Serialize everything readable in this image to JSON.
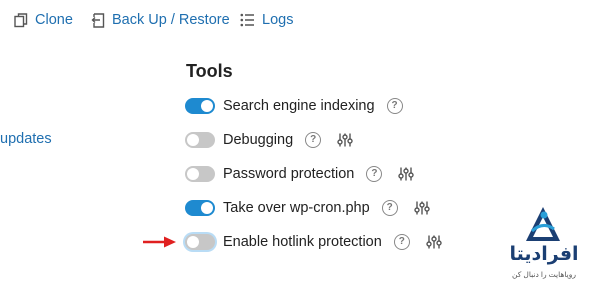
{
  "topbar": {
    "clone_label": "Clone",
    "backup_label": "Back Up / Restore",
    "logs_label": "Logs"
  },
  "sidebar": {
    "updates_link": "updates"
  },
  "tools": {
    "title": "Tools",
    "items": [
      {
        "label": "Search engine indexing",
        "enabled": true,
        "help_icon": "help-icon",
        "settings_icon": null
      },
      {
        "label": "Debugging",
        "enabled": false,
        "help_icon": "help-icon",
        "settings_icon": "sliders-icon"
      },
      {
        "label": "Password protection",
        "enabled": false,
        "help_icon": "help-icon",
        "settings_icon": "sliders-icon"
      },
      {
        "label": "Take over wp-cron.php",
        "enabled": true,
        "help_icon": "help-icon",
        "settings_icon": "sliders-icon"
      },
      {
        "label": "Enable hotlink protection",
        "enabled": false,
        "help_icon": "help-icon",
        "settings_icon": "sliders-icon"
      }
    ]
  },
  "help_glyph": "?",
  "watermark": {
    "brand": "افرادیتا",
    "tagline": "رویاهایت را دنبال کن"
  },
  "colors": {
    "link": "#1f6fb0",
    "toggle_on": "#1e8ad0",
    "toggle_off": "#c7c7c7",
    "annotation_arrow": "#e02020",
    "logo_navy": "#1b3f73"
  }
}
